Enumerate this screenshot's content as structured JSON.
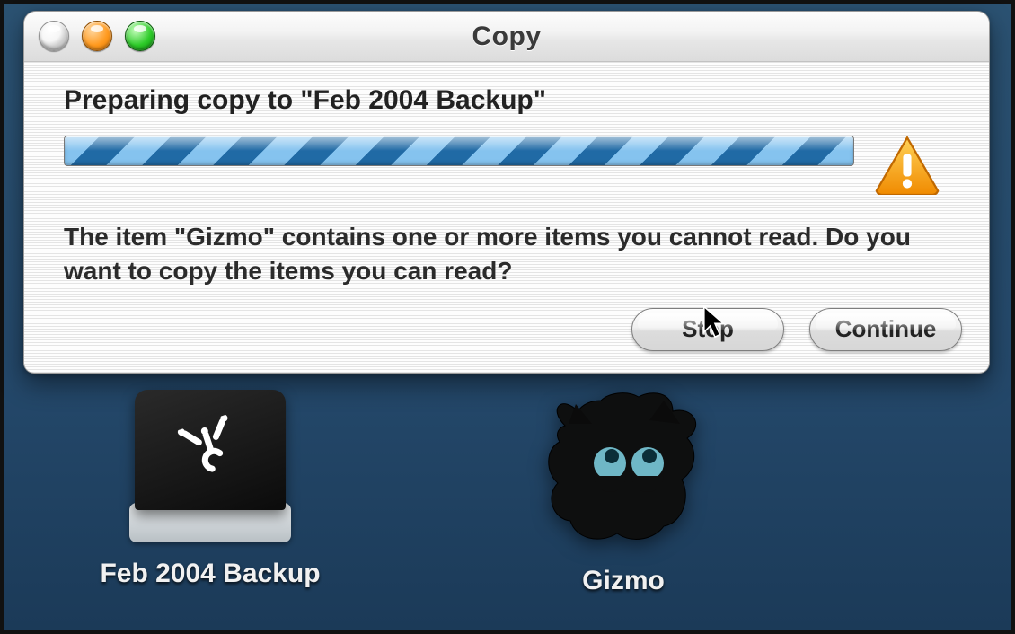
{
  "window": {
    "title": "Copy",
    "heading_prefix": "Preparing copy to ",
    "heading_destination": "\"Feb 2004 Backup\"",
    "message": "The item \"Gizmo\" contains one or more items you cannot read. Do you want to copy the items you can read?",
    "buttons": {
      "stop": "Stop",
      "continue": "Continue"
    }
  },
  "desktop": {
    "icons": [
      {
        "type": "firewire-drive",
        "label": "Feb 2004 Backup"
      },
      {
        "type": "cat-folder",
        "label": "Gizmo"
      }
    ]
  },
  "icons": {
    "warning": "warning-triangle-icon",
    "firewire": "firewire-icon",
    "cursor": "pointer-cursor-icon"
  }
}
